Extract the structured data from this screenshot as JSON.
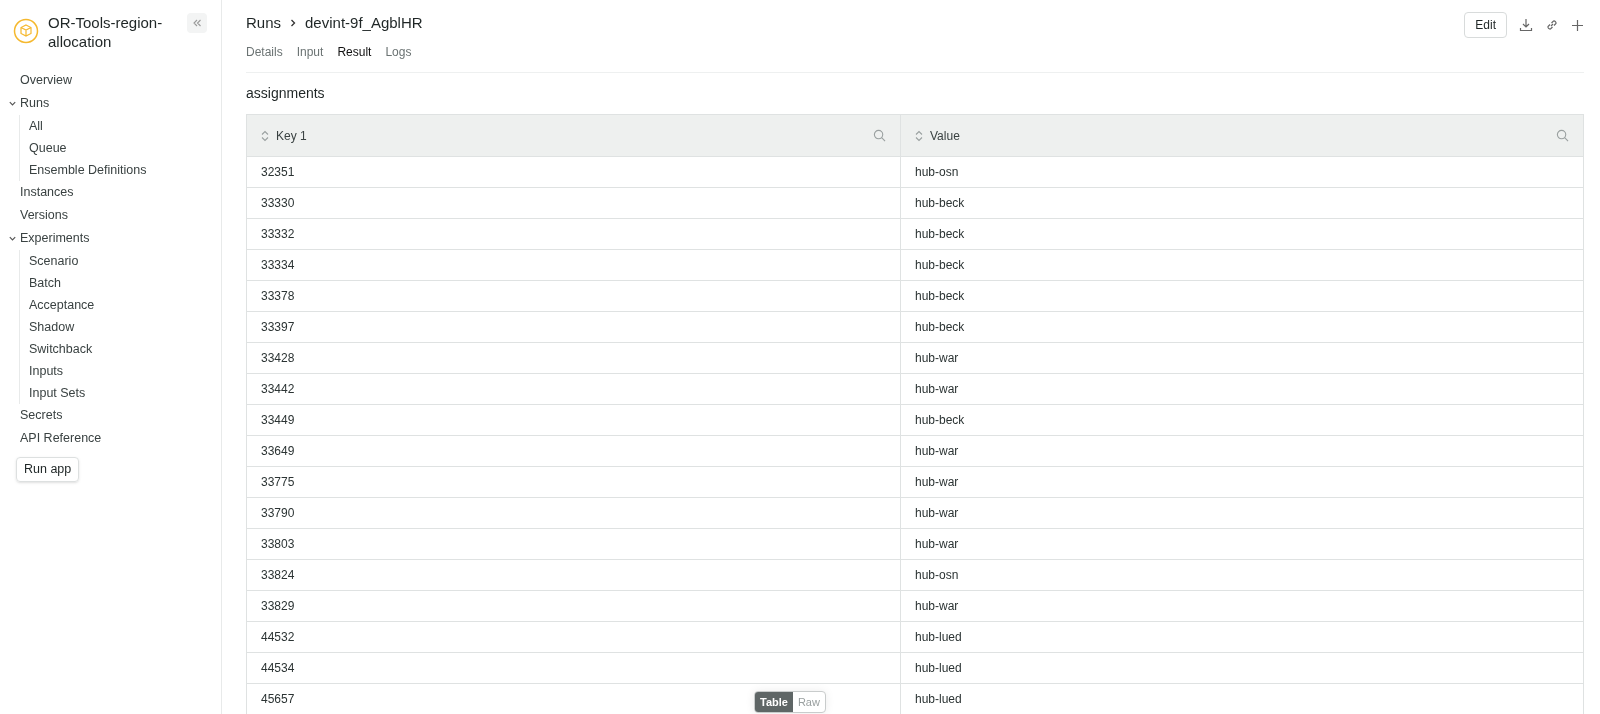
{
  "app": {
    "title": "OR-Tools-region-allocation"
  },
  "sidebar": {
    "items": [
      {
        "label": "Overview"
      },
      {
        "label": "Runs",
        "expanded": true,
        "children": [
          {
            "label": "All"
          },
          {
            "label": "Queue"
          },
          {
            "label": "Ensemble Definitions"
          }
        ]
      },
      {
        "label": "Instances"
      },
      {
        "label": "Versions"
      },
      {
        "label": "Experiments",
        "expanded": true,
        "children": [
          {
            "label": "Scenario"
          },
          {
            "label": "Batch"
          },
          {
            "label": "Acceptance"
          },
          {
            "label": "Shadow"
          },
          {
            "label": "Switchback"
          },
          {
            "label": "Inputs"
          },
          {
            "label": "Input Sets"
          }
        ]
      },
      {
        "label": "Secrets"
      },
      {
        "label": "API Reference"
      }
    ],
    "button": "Run app"
  },
  "breadcrumb": [
    "Runs",
    "devint-9f_AgblHR"
  ],
  "toolbar": {
    "edit": "Edit"
  },
  "tabs": [
    {
      "label": "Details",
      "selected": false
    },
    {
      "label": "Input",
      "selected": false
    },
    {
      "label": "Result",
      "selected": true
    },
    {
      "label": "Logs",
      "selected": false
    }
  ],
  "section_title": "assignments",
  "table": {
    "columns": [
      "Key 1",
      "Value"
    ],
    "rows": [
      [
        "32351",
        "hub-osn"
      ],
      [
        "33330",
        "hub-beck"
      ],
      [
        "33332",
        "hub-beck"
      ],
      [
        "33334",
        "hub-beck"
      ],
      [
        "33378",
        "hub-beck"
      ],
      [
        "33397",
        "hub-beck"
      ],
      [
        "33428",
        "hub-war"
      ],
      [
        "33442",
        "hub-war"
      ],
      [
        "33449",
        "hub-beck"
      ],
      [
        "33649",
        "hub-war"
      ],
      [
        "33775",
        "hub-war"
      ],
      [
        "33790",
        "hub-war"
      ],
      [
        "33803",
        "hub-war"
      ],
      [
        "33824",
        "hub-osn"
      ],
      [
        "33829",
        "hub-war"
      ],
      [
        "44532",
        "hub-lued"
      ],
      [
        "44534",
        "hub-lued"
      ],
      [
        "45657",
        "hub-lued"
      ]
    ]
  },
  "view_toggle": [
    {
      "label": "Table",
      "selected": true
    },
    {
      "label": "Raw",
      "selected": false
    }
  ]
}
